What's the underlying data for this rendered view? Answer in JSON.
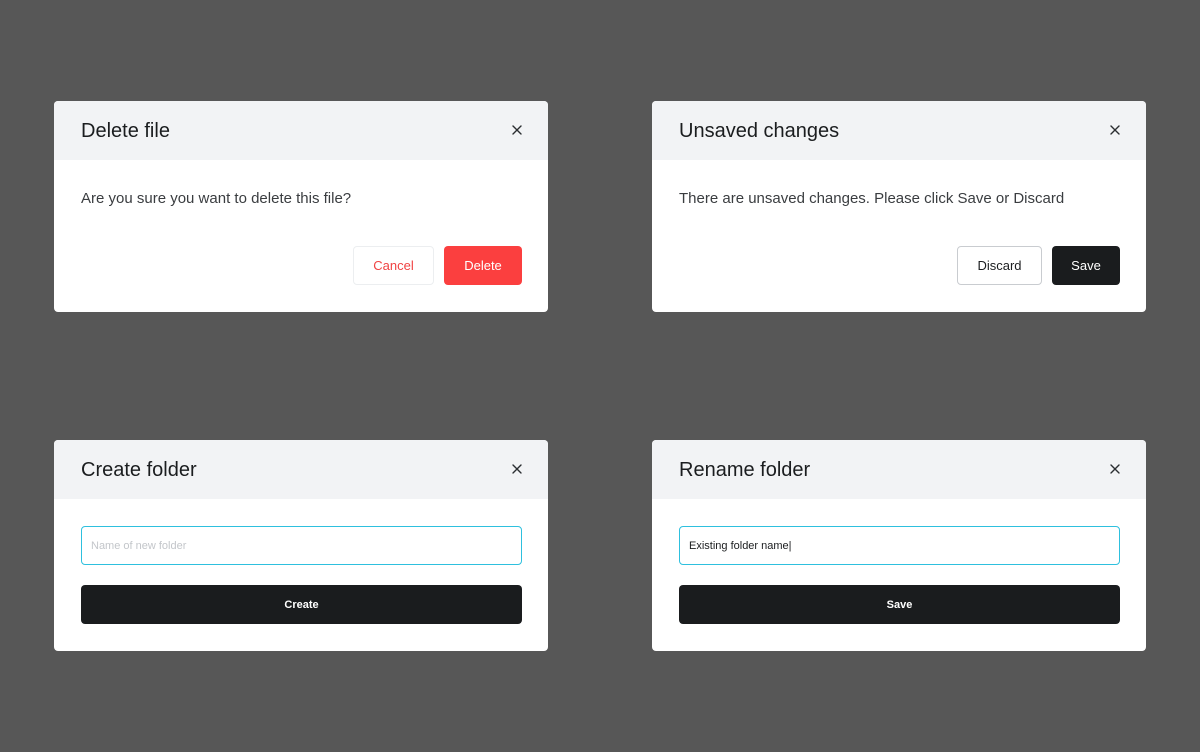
{
  "colors": {
    "page_background": "#575757",
    "modal_header": "#f2f3f5",
    "danger": "#fb3f3f",
    "primary_dark": "#1a1c1e",
    "input_focus": "#2ec0de"
  },
  "icons": {
    "close": "close-icon"
  },
  "modals": [
    {
      "title": "Delete file",
      "message": "Are you sure you want to delete this file?",
      "buttons": {
        "secondary": "Cancel",
        "primary": "Delete"
      }
    },
    {
      "title": "Unsaved changes",
      "message": "There are unsaved changes. Please click Save or Discard",
      "buttons": {
        "secondary": "Discard",
        "primary": "Save"
      }
    },
    {
      "title": "Create folder",
      "input": {
        "placeholder": "Name of new folder",
        "value": ""
      },
      "buttons": {
        "primary": "Create"
      }
    },
    {
      "title": "Rename folder",
      "input": {
        "placeholder": "",
        "value": "Existing folder name|"
      },
      "buttons": {
        "primary": "Save"
      }
    }
  ]
}
